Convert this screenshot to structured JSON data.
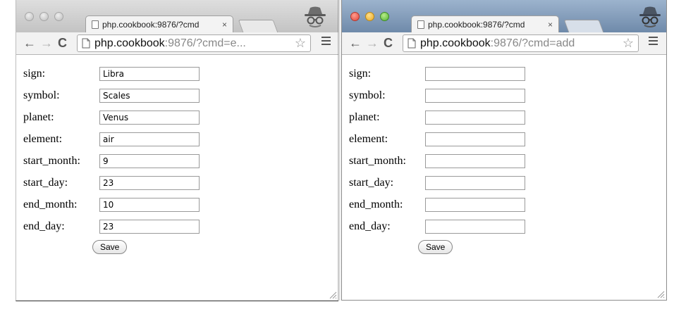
{
  "windows": [
    {
      "tab": {
        "title": "php.cookbook:9876/?cmd",
        "close": "×"
      },
      "url": {
        "host": "php.cookbook",
        "rest": ":9876/?cmd=e..."
      },
      "icons": [
        "page-icon",
        "back-arrow-icon",
        "forward-arrow-icon",
        "reload-icon",
        "star-icon",
        "menu-icon",
        "incognito-icon",
        "resize-grip-icon"
      ],
      "form": {
        "fields": [
          {
            "label": "sign:",
            "value": "Libra"
          },
          {
            "label": "symbol:",
            "value": "Scales"
          },
          {
            "label": "planet:",
            "value": "Venus"
          },
          {
            "label": "element:",
            "value": "air"
          },
          {
            "label": "start_month:",
            "value": "9"
          },
          {
            "label": "start_day:",
            "value": "23"
          },
          {
            "label": "end_month:",
            "value": "10"
          },
          {
            "label": "end_day:",
            "value": "23"
          }
        ],
        "save_label": "Save"
      }
    },
    {
      "tab": {
        "title": "php.cookbook:9876/?cmd",
        "close": "×"
      },
      "url": {
        "host": "php.cookbook",
        "rest": ":9876/?cmd=add"
      },
      "icons": [
        "page-icon",
        "back-arrow-icon",
        "forward-arrow-icon",
        "reload-icon",
        "star-icon",
        "menu-icon",
        "incognito-icon",
        "resize-grip-icon"
      ],
      "form": {
        "fields": [
          {
            "label": "sign:",
            "value": ""
          },
          {
            "label": "symbol:",
            "value": ""
          },
          {
            "label": "planet:",
            "value": ""
          },
          {
            "label": "element:",
            "value": ""
          },
          {
            "label": "start_month:",
            "value": ""
          },
          {
            "label": "start_day:",
            "value": ""
          },
          {
            "label": "end_month:",
            "value": ""
          },
          {
            "label": "end_day:",
            "value": ""
          }
        ],
        "save_label": "Save"
      }
    }
  ],
  "nav": {
    "back": "←",
    "forward": "→",
    "reload": "C",
    "star": "☆"
  },
  "colors": {
    "inactive_titlebar": "#c3c3c3",
    "active_titlebar": "#6f8aaa",
    "close_light": "#e0443a",
    "minimize_light": "#e8a825",
    "maximize_light": "#52b331"
  }
}
